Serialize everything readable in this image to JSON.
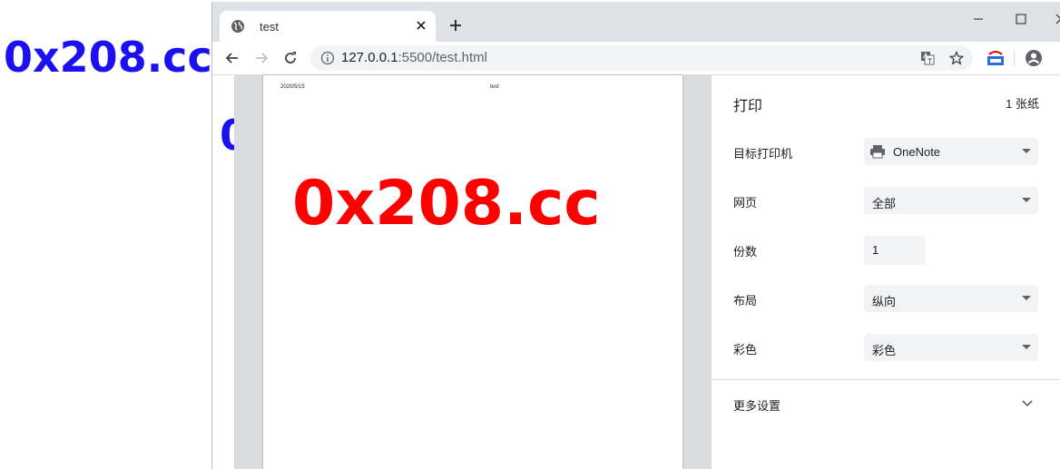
{
  "desktop": {
    "bg_text": "0x208.cc"
  },
  "browser": {
    "tab": {
      "title": "test"
    },
    "address": {
      "host": "127.0.0.1",
      "rest": ":5500/test.html"
    },
    "partial_page_text": "0"
  },
  "preview": {
    "header_date": "2020/5/15",
    "header_title": "test",
    "content_text": "0x208.cc"
  },
  "print_panel": {
    "title": "打印",
    "sheet_count": "1 张纸",
    "destination": {
      "label": "目标打印机",
      "value": "OneNote"
    },
    "pages": {
      "label": "网页",
      "value": "全部"
    },
    "copies": {
      "label": "份数",
      "value": "1"
    },
    "layout": {
      "label": "布局",
      "value": "纵向"
    },
    "color": {
      "label": "彩色",
      "value": "彩色"
    },
    "more_settings": "更多设置"
  },
  "colors": {
    "bg_text": "#1a10f0",
    "page_text": "#ff0000"
  }
}
